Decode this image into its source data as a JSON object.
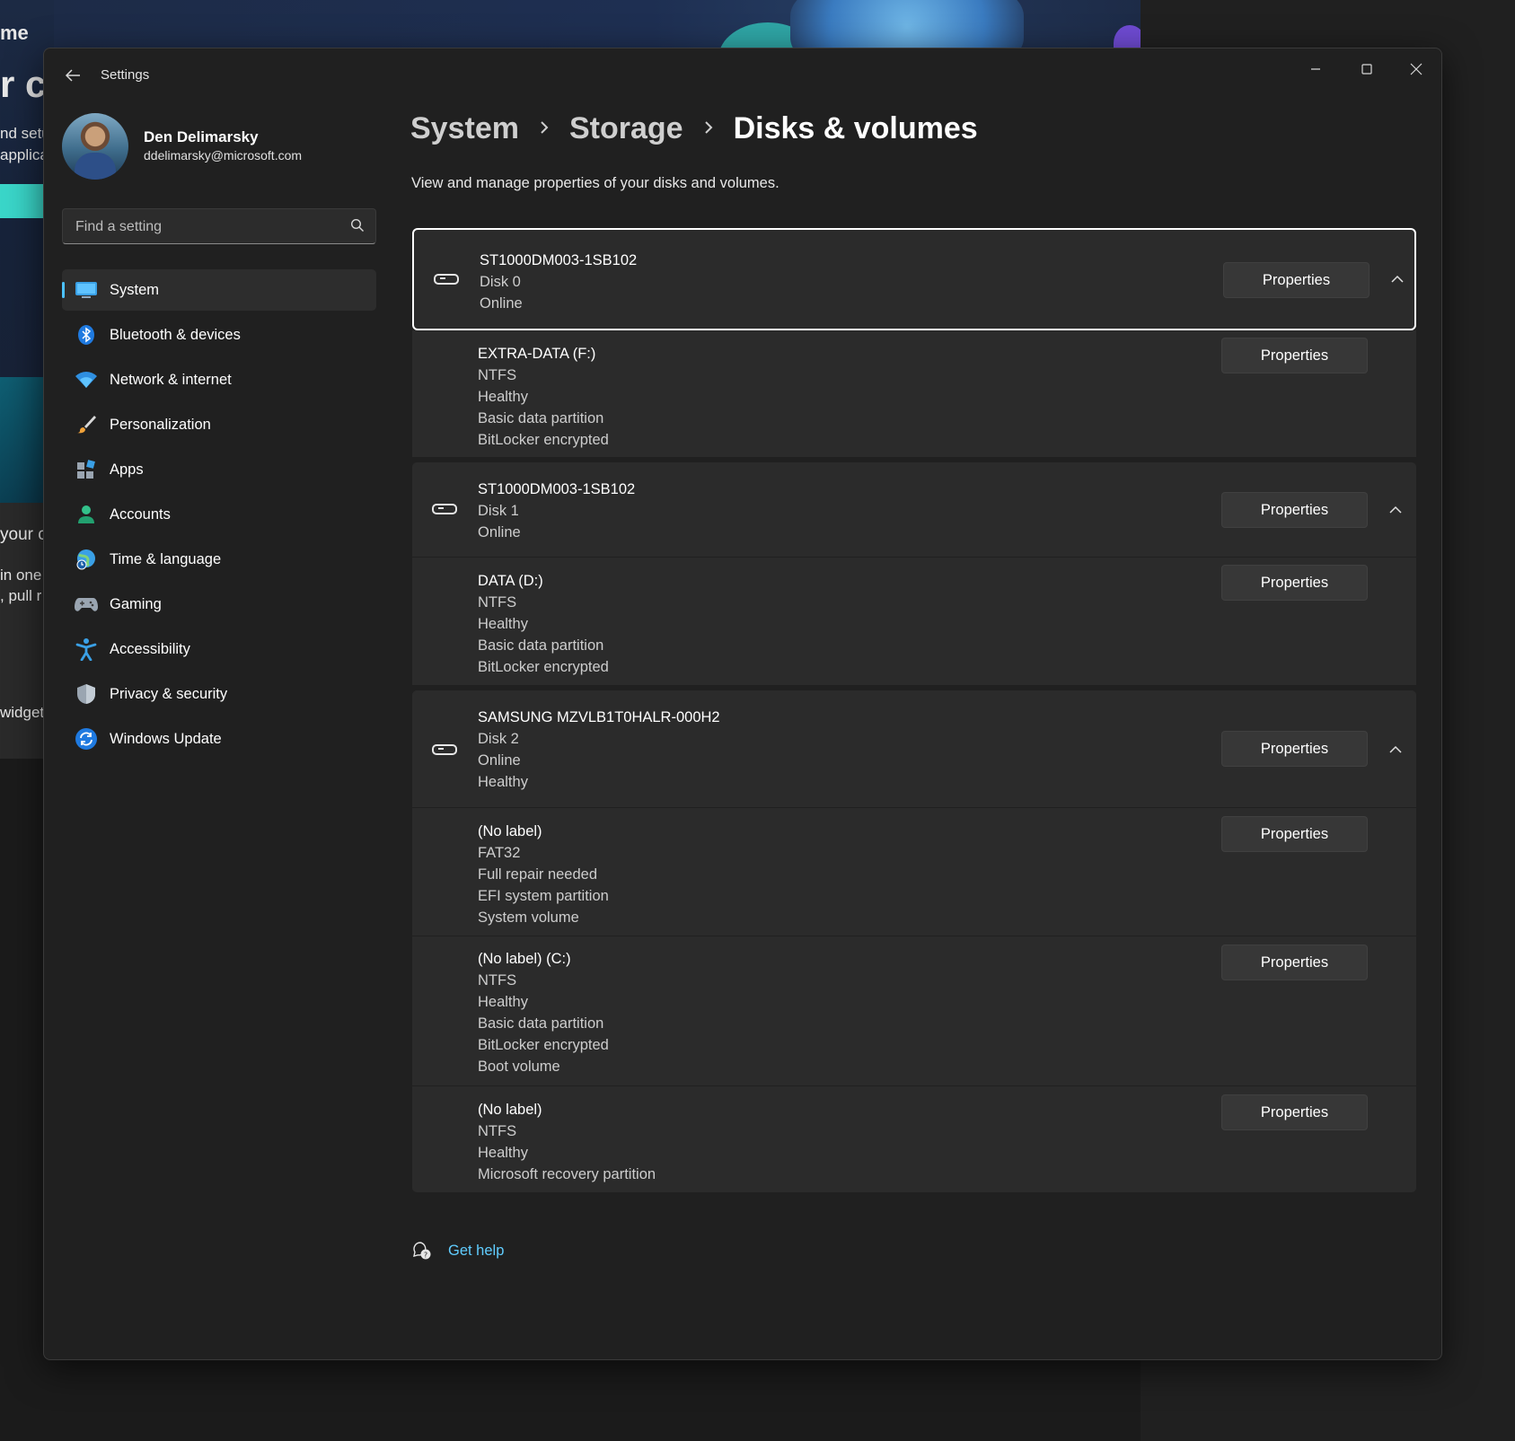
{
  "background": {
    "texts": [
      "me",
      "r c",
      "nd setu",
      "applica",
      "your c",
      "in one",
      ", pull r",
      "widget"
    ]
  },
  "window": {
    "title": "Settings"
  },
  "profile": {
    "name": "Den Delimarsky",
    "email": "ddelimarsky@microsoft.com"
  },
  "search": {
    "placeholder": "Find a setting"
  },
  "nav": [
    {
      "label": "System",
      "icon": "system-icon",
      "active": true
    },
    {
      "label": "Bluetooth & devices",
      "icon": "bluetooth-icon"
    },
    {
      "label": "Network & internet",
      "icon": "wifi-icon"
    },
    {
      "label": "Personalization",
      "icon": "brush-icon"
    },
    {
      "label": "Apps",
      "icon": "apps-icon"
    },
    {
      "label": "Accounts",
      "icon": "accounts-icon"
    },
    {
      "label": "Time & language",
      "icon": "time-language-icon"
    },
    {
      "label": "Gaming",
      "icon": "gamepad-icon"
    },
    {
      "label": "Accessibility",
      "icon": "accessibility-icon"
    },
    {
      "label": "Privacy & security",
      "icon": "shield-icon"
    },
    {
      "label": "Windows Update",
      "icon": "update-icon"
    }
  ],
  "breadcrumb": [
    "System",
    "Storage",
    "Disks & volumes"
  ],
  "subtitle": "View and manage properties of your disks and volumes.",
  "properties_label": "Properties",
  "disks": [
    {
      "lines": [
        "ST1000DM003-1SB102",
        "Disk 0",
        "Online"
      ],
      "volumes": [
        {
          "lines": [
            "EXTRA-DATA (F:)",
            "NTFS",
            "Healthy",
            "Basic data partition",
            "BitLocker encrypted"
          ]
        }
      ]
    },
    {
      "lines": [
        "ST1000DM003-1SB102",
        "Disk 1",
        "Online"
      ],
      "volumes": [
        {
          "lines": [
            "DATA (D:)",
            "NTFS",
            "Healthy",
            "Basic data partition",
            "BitLocker encrypted"
          ]
        }
      ]
    },
    {
      "lines": [
        "SAMSUNG MZVLB1T0HALR-000H2",
        "Disk 2",
        "Online",
        "Healthy"
      ],
      "volumes": [
        {
          "lines": [
            "(No label)",
            "FAT32",
            "Full repair needed",
            "EFI system partition",
            "System volume"
          ]
        },
        {
          "lines": [
            "(No label) (C:)",
            "NTFS",
            "Healthy",
            "Basic data partition",
            "BitLocker encrypted",
            "Boot volume"
          ]
        },
        {
          "lines": [
            "(No label)",
            "NTFS",
            "Healthy",
            "Microsoft recovery partition"
          ]
        }
      ]
    }
  ],
  "help": {
    "label": "Get help"
  },
  "colors": {
    "accent": "#4cc2ff",
    "link": "#60cdff",
    "window_bg": "#202020",
    "card_bg": "#2b2b2b"
  }
}
